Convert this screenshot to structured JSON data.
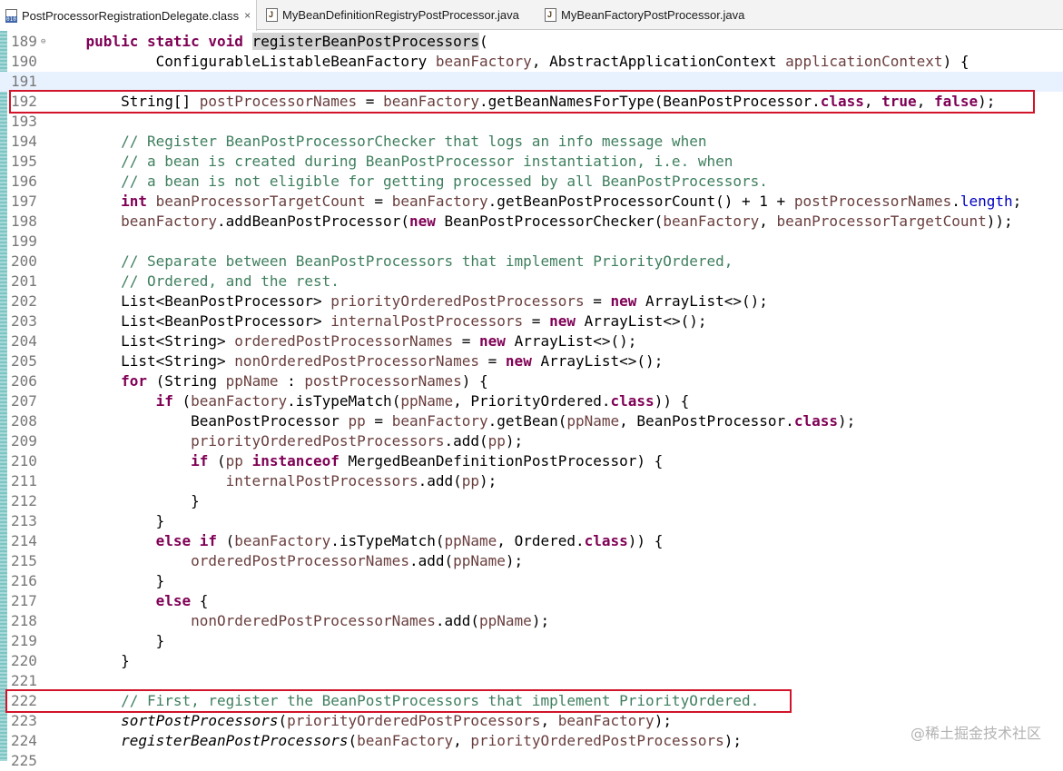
{
  "tabs": [
    {
      "label": "PostProcessorRegistrationDelegate.class",
      "icon": "class-file-icon",
      "active": true,
      "closable": true
    },
    {
      "label": "MyBeanDefinitionRegistryPostProcessor.java",
      "icon": "java-file-icon",
      "active": false,
      "closable": false
    },
    {
      "label": "MyBeanFactoryPostProcessor.java",
      "icon": "java-file-icon",
      "active": false,
      "closable": false
    }
  ],
  "close_icon": "×",
  "lines": [
    {
      "n": "189",
      "fold": true,
      "s": [
        [
          "    ",
          ""
        ],
        [
          "public static void",
          "kw"
        ],
        [
          " ",
          ""
        ],
        [
          "registerBeanPostProcessors",
          "hl"
        ],
        [
          "(",
          ""
        ]
      ]
    },
    {
      "n": "190",
      "s": [
        [
          "            ConfigurableListableBeanFactory ",
          ""
        ],
        [
          "beanFactory",
          "var"
        ],
        [
          ", AbstractApplicationContext ",
          ""
        ],
        [
          "applicationContext",
          "var"
        ],
        [
          ") {",
          ""
        ]
      ]
    },
    {
      "n": "191",
      "cur": true,
      "s": []
    },
    {
      "n": "192",
      "s": [
        [
          "        String[] ",
          ""
        ],
        [
          "postProcessorNames",
          "var"
        ],
        [
          " = ",
          ""
        ],
        [
          "beanFactory",
          "var"
        ],
        [
          ".getBeanNamesForType(BeanPostProcessor.",
          ""
        ],
        [
          "class",
          "kw"
        ],
        [
          ", ",
          ""
        ],
        [
          "true",
          "kw"
        ],
        [
          ", ",
          ""
        ],
        [
          "false",
          "kw"
        ],
        [
          ");",
          ""
        ]
      ]
    },
    {
      "n": "193",
      "s": []
    },
    {
      "n": "194",
      "s": [
        [
          "        ",
          ""
        ],
        [
          "// Register BeanPostProcessorChecker that logs an info message when",
          "cm"
        ]
      ]
    },
    {
      "n": "195",
      "s": [
        [
          "        ",
          ""
        ],
        [
          "// a bean is created during BeanPostProcessor instantiation, i.e. when",
          "cm"
        ]
      ]
    },
    {
      "n": "196",
      "s": [
        [
          "        ",
          ""
        ],
        [
          "// a bean is not eligible for getting processed by all BeanPostProcessors.",
          "cm"
        ]
      ]
    },
    {
      "n": "197",
      "s": [
        [
          "        ",
          ""
        ],
        [
          "int",
          "kw"
        ],
        [
          " ",
          ""
        ],
        [
          "beanProcessorTargetCount",
          "var"
        ],
        [
          " = ",
          ""
        ],
        [
          "beanFactory",
          "var"
        ],
        [
          ".getBeanPostProcessorCount() + 1 + ",
          ""
        ],
        [
          "postProcessorNames",
          "var"
        ],
        [
          ".",
          ""
        ],
        [
          "length",
          "fld"
        ],
        [
          ";",
          ""
        ]
      ]
    },
    {
      "n": "198",
      "s": [
        [
          "        ",
          ""
        ],
        [
          "beanFactory",
          "var"
        ],
        [
          ".addBeanPostProcessor(",
          ""
        ],
        [
          "new",
          "kw"
        ],
        [
          " BeanPostProcessorChecker(",
          ""
        ],
        [
          "beanFactory",
          "var"
        ],
        [
          ", ",
          ""
        ],
        [
          "beanProcessorTargetCount",
          "var"
        ],
        [
          "));",
          ""
        ]
      ]
    },
    {
      "n": "199",
      "s": []
    },
    {
      "n": "200",
      "s": [
        [
          "        ",
          ""
        ],
        [
          "// Separate between BeanPostProcessors that implement PriorityOrdered,",
          "cm"
        ]
      ]
    },
    {
      "n": "201",
      "s": [
        [
          "        ",
          ""
        ],
        [
          "// Ordered, and the rest.",
          "cm"
        ]
      ]
    },
    {
      "n": "202",
      "s": [
        [
          "        List<BeanPostProcessor> ",
          ""
        ],
        [
          "priorityOrderedPostProcessors",
          "var"
        ],
        [
          " = ",
          ""
        ],
        [
          "new",
          "kw"
        ],
        [
          " ArrayList<>();",
          ""
        ]
      ]
    },
    {
      "n": "203",
      "s": [
        [
          "        List<BeanPostProcessor> ",
          ""
        ],
        [
          "internalPostProcessors",
          "var"
        ],
        [
          " = ",
          ""
        ],
        [
          "new",
          "kw"
        ],
        [
          " ArrayList<>();",
          ""
        ]
      ]
    },
    {
      "n": "204",
      "s": [
        [
          "        List<String> ",
          ""
        ],
        [
          "orderedPostProcessorNames",
          "var"
        ],
        [
          " = ",
          ""
        ],
        [
          "new",
          "kw"
        ],
        [
          " ArrayList<>();",
          ""
        ]
      ]
    },
    {
      "n": "205",
      "s": [
        [
          "        List<String> ",
          ""
        ],
        [
          "nonOrderedPostProcessorNames",
          "var"
        ],
        [
          " = ",
          ""
        ],
        [
          "new",
          "kw"
        ],
        [
          " ArrayList<>();",
          ""
        ]
      ]
    },
    {
      "n": "206",
      "s": [
        [
          "        ",
          ""
        ],
        [
          "for",
          "kw"
        ],
        [
          " (String ",
          ""
        ],
        [
          "ppName",
          "var"
        ],
        [
          " : ",
          ""
        ],
        [
          "postProcessorNames",
          "var"
        ],
        [
          ") {",
          ""
        ]
      ]
    },
    {
      "n": "207",
      "s": [
        [
          "            ",
          ""
        ],
        [
          "if",
          "kw"
        ],
        [
          " (",
          ""
        ],
        [
          "beanFactory",
          "var"
        ],
        [
          ".isTypeMatch(",
          ""
        ],
        [
          "ppName",
          "var"
        ],
        [
          ", PriorityOrdered.",
          ""
        ],
        [
          "class",
          "kw"
        ],
        [
          ")) {",
          ""
        ]
      ]
    },
    {
      "n": "208",
      "s": [
        [
          "                BeanPostProcessor ",
          ""
        ],
        [
          "pp",
          "var"
        ],
        [
          " = ",
          ""
        ],
        [
          "beanFactory",
          "var"
        ],
        [
          ".getBean(",
          ""
        ],
        [
          "ppName",
          "var"
        ],
        [
          ", BeanPostProcessor.",
          ""
        ],
        [
          "class",
          "kw"
        ],
        [
          ");",
          ""
        ]
      ]
    },
    {
      "n": "209",
      "s": [
        [
          "                ",
          ""
        ],
        [
          "priorityOrderedPostProcessors",
          "var"
        ],
        [
          ".add(",
          ""
        ],
        [
          "pp",
          "var"
        ],
        [
          ");",
          ""
        ]
      ]
    },
    {
      "n": "210",
      "s": [
        [
          "                ",
          ""
        ],
        [
          "if",
          "kw"
        ],
        [
          " (",
          ""
        ],
        [
          "pp",
          "var"
        ],
        [
          " ",
          ""
        ],
        [
          "instanceof",
          "kw"
        ],
        [
          " MergedBeanDefinitionPostProcessor) {",
          ""
        ]
      ]
    },
    {
      "n": "211",
      "s": [
        [
          "                    ",
          ""
        ],
        [
          "internalPostProcessors",
          "var"
        ],
        [
          ".add(",
          ""
        ],
        [
          "pp",
          "var"
        ],
        [
          ");",
          ""
        ]
      ]
    },
    {
      "n": "212",
      "s": [
        [
          "                }",
          ""
        ]
      ]
    },
    {
      "n": "213",
      "s": [
        [
          "            }",
          ""
        ]
      ]
    },
    {
      "n": "214",
      "s": [
        [
          "            ",
          ""
        ],
        [
          "else if",
          "kw"
        ],
        [
          " (",
          ""
        ],
        [
          "beanFactory",
          "var"
        ],
        [
          ".isTypeMatch(",
          ""
        ],
        [
          "ppName",
          "var"
        ],
        [
          ", Ordered.",
          ""
        ],
        [
          "class",
          "kw"
        ],
        [
          ")) {",
          ""
        ]
      ]
    },
    {
      "n": "215",
      "s": [
        [
          "                ",
          ""
        ],
        [
          "orderedPostProcessorNames",
          "var"
        ],
        [
          ".add(",
          ""
        ],
        [
          "ppName",
          "var"
        ],
        [
          ");",
          ""
        ]
      ]
    },
    {
      "n": "216",
      "s": [
        [
          "            }",
          ""
        ]
      ]
    },
    {
      "n": "217",
      "s": [
        [
          "            ",
          ""
        ],
        [
          "else",
          "kw"
        ],
        [
          " {",
          ""
        ]
      ]
    },
    {
      "n": "218",
      "s": [
        [
          "                ",
          ""
        ],
        [
          "nonOrderedPostProcessorNames",
          "var"
        ],
        [
          ".add(",
          ""
        ],
        [
          "ppName",
          "var"
        ],
        [
          ");",
          ""
        ]
      ]
    },
    {
      "n": "219",
      "s": [
        [
          "            }",
          ""
        ]
      ]
    },
    {
      "n": "220",
      "s": [
        [
          "        }",
          ""
        ]
      ]
    },
    {
      "n": "221",
      "s": []
    },
    {
      "n": "222",
      "s": [
        [
          "        ",
          ""
        ],
        [
          "// First, register the BeanPostProcessors that implement PriorityOrdered.",
          "cm"
        ]
      ]
    },
    {
      "n": "223",
      "s": [
        [
          "        ",
          ""
        ],
        [
          "sortPostProcessors",
          "mth"
        ],
        [
          "(",
          ""
        ],
        [
          "priorityOrderedPostProcessors",
          "var"
        ],
        [
          ", ",
          ""
        ],
        [
          "beanFactory",
          "var"
        ],
        [
          ");",
          ""
        ]
      ]
    },
    {
      "n": "224",
      "s": [
        [
          "        ",
          ""
        ],
        [
          "registerBeanPostProcessors",
          "mth"
        ],
        [
          "(",
          ""
        ],
        [
          "beanFactory",
          "var"
        ],
        [
          ", ",
          ""
        ],
        [
          "priorityOrderedPostProcessors",
          "var"
        ],
        [
          ");",
          ""
        ]
      ]
    },
    {
      "n": "225",
      "s": []
    }
  ],
  "highlight_boxes": [
    "192",
    "222"
  ],
  "watermark": "@稀土掘金技术社区"
}
